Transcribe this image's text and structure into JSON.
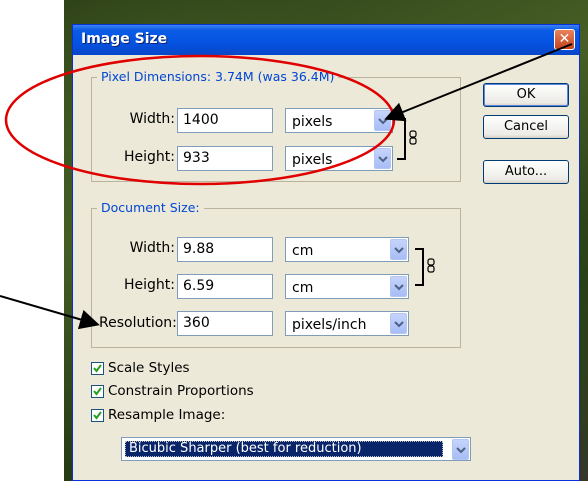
{
  "window": {
    "title": "Image Size",
    "close_symbol": "✕"
  },
  "pixel_dimensions": {
    "legend": "Pixel Dimensions:  3.74M (was 36.4M)",
    "width_label": "Width:",
    "width_value": "1400",
    "width_unit": "pixels",
    "height_label": "Height:",
    "height_value": "933",
    "height_unit": "pixels"
  },
  "document_size": {
    "legend": "Document Size:",
    "width_label": "Width:",
    "width_value": "9.88",
    "width_unit": "cm",
    "height_label": "Height:",
    "height_value": "6.59",
    "height_unit": "cm",
    "resolution_label": "Resolution:",
    "resolution_value": "360",
    "resolution_unit": "pixels/inch"
  },
  "buttons": {
    "ok": "OK",
    "cancel": "Cancel",
    "auto": "Auto..."
  },
  "options": {
    "scale_styles": "Scale Styles",
    "constrain": "Constrain Proportions",
    "resample": "Resample Image:",
    "scale_styles_checked": true,
    "constrain_checked": true,
    "resample_checked": true,
    "resample_method": "Bicubic Sharper (best for reduction)"
  },
  "annotations": {
    "ellipse_color": "#e00000",
    "arrow_color": "#000000"
  },
  "colors": {
    "title_blue": "#0553e1",
    "legend_blue": "#0046d5",
    "dialog_bg": "#ece9d8"
  }
}
